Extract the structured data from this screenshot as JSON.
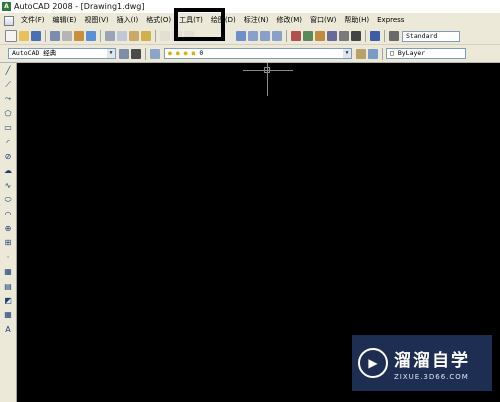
{
  "window": {
    "title": "AutoCAD 2008 - [Drawing1.dwg]",
    "app_icon_letter": "A"
  },
  "menubar": {
    "items": [
      "文件(F)",
      "编辑(E)",
      "视图(V)",
      "插入(I)",
      "格式(O)",
      "工具(T)",
      "绘图(D)",
      "标注(N)",
      "修改(M)",
      "窗口(W)",
      "帮助(H)",
      "Express"
    ]
  },
  "toolbar": {
    "text_style": "Standard",
    "workspace": "AutoCAD 经典",
    "layer_value": "0",
    "color_value": "ByLayer"
  },
  "left_toolbar": {
    "icons": [
      "line-icon",
      "construction-line-icon",
      "polyline-icon",
      "polygon-icon",
      "rectangle-icon",
      "arc-icon",
      "circle-icon",
      "revision-cloud-icon",
      "spline-icon",
      "ellipse-icon",
      "ellipse-arc-icon",
      "insert-block-icon",
      "make-block-icon",
      "point-icon",
      "hatch-icon",
      "gradient-icon",
      "region-icon",
      "table-icon",
      "multiline-text-icon"
    ],
    "glyphs": [
      "╱",
      "⟋",
      "⤳",
      "⬠",
      "▭",
      "◜",
      "⊘",
      "☁",
      "∿",
      "⬭",
      "◠",
      "⊕",
      "⊞",
      "·",
      "▦",
      "▤",
      "◩",
      "▦",
      "A"
    ]
  },
  "watermark": {
    "title": "溜溜自学",
    "subtitle": "ZIXUE.3D66.COM"
  },
  "colors": {
    "canvas": "#000000",
    "highlight_box": "#000000",
    "chrome": "#ece9d8"
  }
}
